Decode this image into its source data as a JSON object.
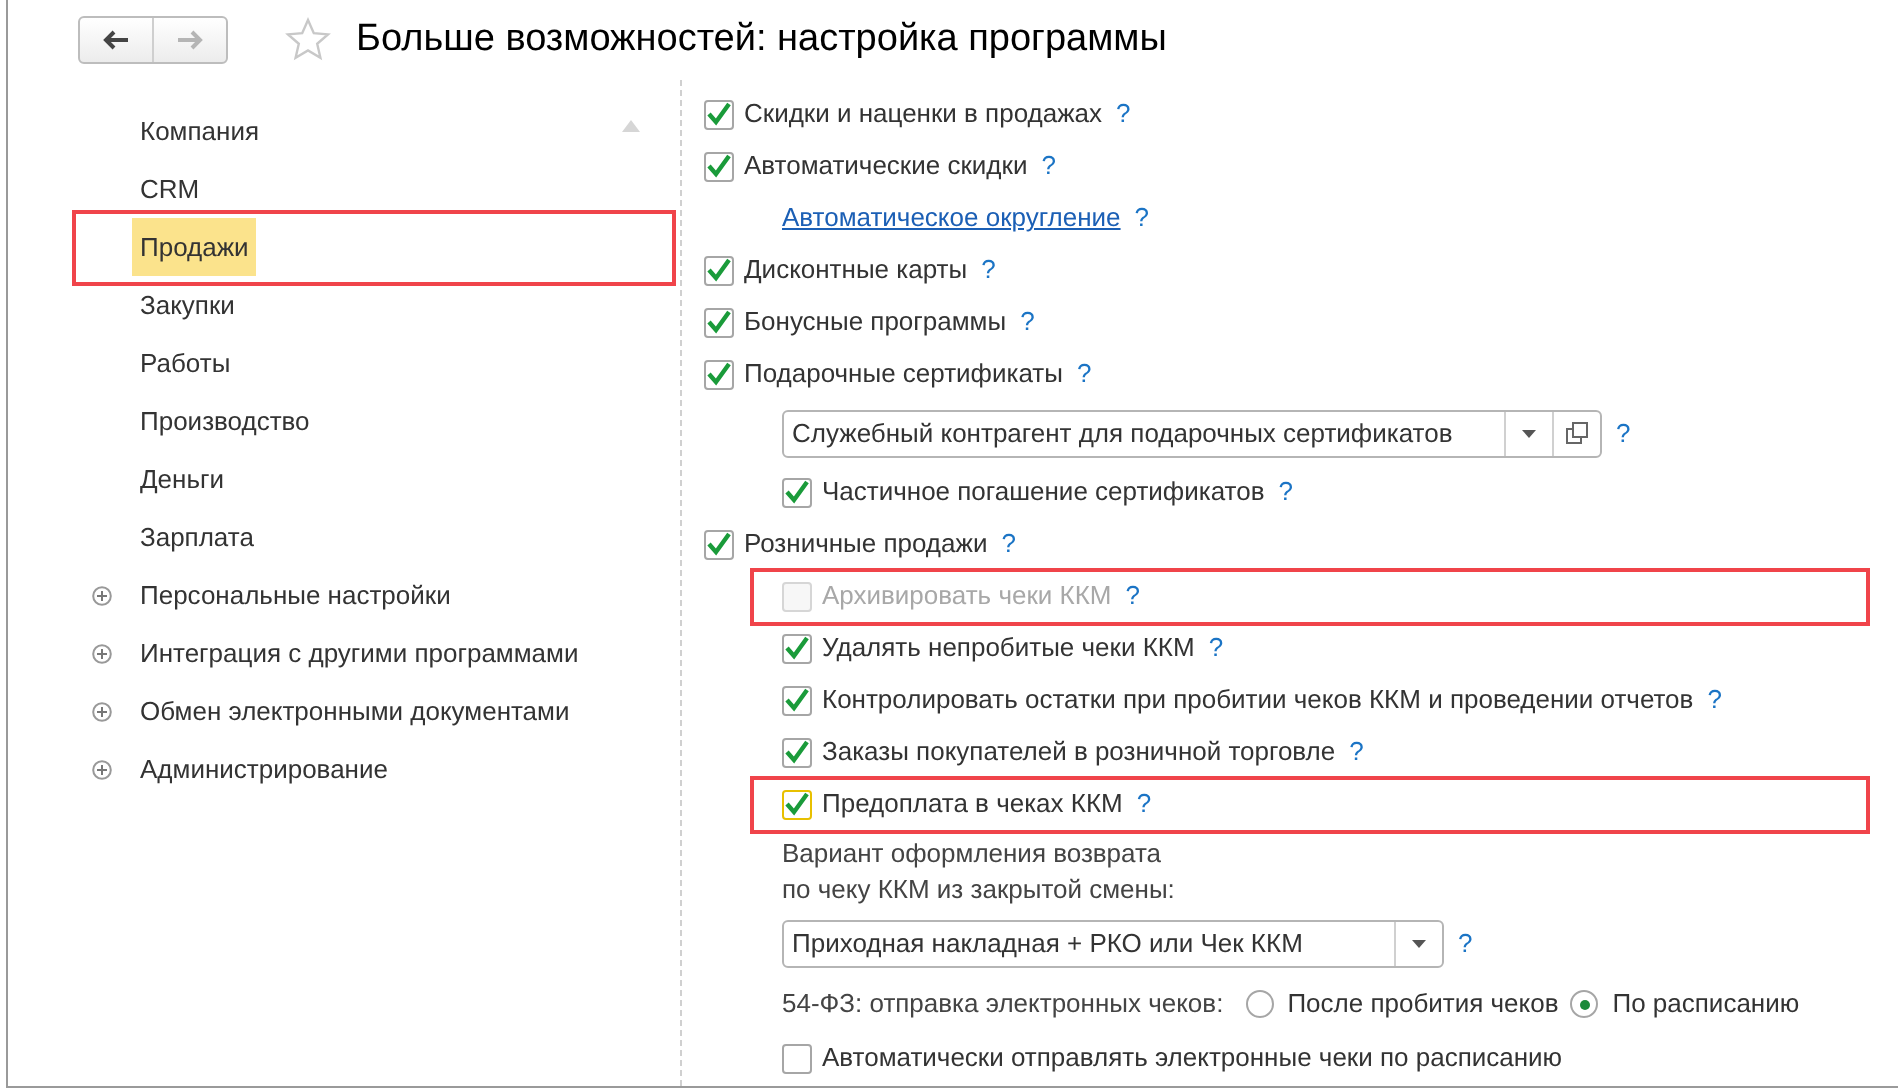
{
  "window": {
    "title": "Больше возможностей: настройка программы",
    "back_enabled": true,
    "forward_enabled": false
  },
  "sidebar": {
    "items": [
      {
        "label": "Компания",
        "selected": false,
        "expandable": false,
        "highlighted": false
      },
      {
        "label": "CRM",
        "selected": false,
        "expandable": false,
        "highlighted": false
      },
      {
        "label": "Продажи",
        "selected": true,
        "expandable": false,
        "highlighted": true
      },
      {
        "label": "Закупки",
        "selected": false,
        "expandable": false,
        "highlighted": false
      },
      {
        "label": "Работы",
        "selected": false,
        "expandable": false,
        "highlighted": false
      },
      {
        "label": "Производство",
        "selected": false,
        "expandable": false,
        "highlighted": false
      },
      {
        "label": "Деньги",
        "selected": false,
        "expandable": false,
        "highlighted": false
      },
      {
        "label": "Зарплата",
        "selected": false,
        "expandable": false,
        "highlighted": false
      },
      {
        "label": "Персональные настройки",
        "selected": false,
        "expandable": true,
        "highlighted": false
      },
      {
        "label": "Интеграция с другими программами",
        "selected": false,
        "expandable": true,
        "highlighted": false
      },
      {
        "label": "Обмен электронными документами",
        "selected": false,
        "expandable": true,
        "highlighted": false
      },
      {
        "label": "Администрирование",
        "selected": false,
        "expandable": true,
        "highlighted": false
      }
    ]
  },
  "settings": [
    {
      "kind": "checkbox",
      "label": "Скидки и наценки в продажах",
      "checked": true,
      "help": "?"
    },
    {
      "kind": "checkbox",
      "label": "Автоматические скидки",
      "checked": true,
      "help": "?",
      "children": [
        {
          "kind": "link",
          "label": "Автоматическое округление",
          "help": "?"
        }
      ]
    },
    {
      "kind": "checkbox",
      "label": "Дисконтные карты",
      "checked": true,
      "help": "?"
    },
    {
      "kind": "checkbox",
      "label": "Бонусные программы",
      "checked": true,
      "help": "?"
    },
    {
      "kind": "checkbox",
      "label": "Подарочные сертификаты",
      "checked": true,
      "help": "?",
      "children": [
        {
          "kind": "combo",
          "value": "Служебный контрагент для подарочных сертификатов",
          "open_button": true,
          "help": "?"
        },
        {
          "kind": "checkbox",
          "label": "Частичное погашение сертификатов",
          "checked": true,
          "help": "?"
        }
      ]
    },
    {
      "kind": "checkbox",
      "label": "Розничные продажи",
      "checked": true,
      "help": "?",
      "children": [
        {
          "kind": "checkbox",
          "label": "Архивировать чеки ККМ",
          "checked": false,
          "disabled": true,
          "highlighted": true,
          "help": "?"
        },
        {
          "kind": "checkbox",
          "label": "Удалять непробитые чеки ККМ",
          "checked": true,
          "help": "?"
        },
        {
          "kind": "checkbox",
          "label": "Контролировать остатки при пробитии чеков ККМ и проведении отчетов",
          "checked": true,
          "help": "?"
        },
        {
          "kind": "checkbox",
          "label": "Заказы покупателей в розничной торговле",
          "checked": true,
          "help": "?"
        },
        {
          "kind": "checkbox",
          "label": "Предоплата в чеках ККМ",
          "checked": true,
          "focused": true,
          "highlighted": true,
          "help": "?"
        },
        {
          "kind": "label",
          "lines": [
            "Вариант оформления возврата",
            "по чеку ККМ из закрытой смены:"
          ]
        },
        {
          "kind": "combo",
          "value": "Приходная накладная + РКО или Чек ККМ",
          "open_button": false,
          "help": "?"
        },
        {
          "kind": "radio",
          "label": "54-ФЗ: отправка электронных чеков:",
          "options": [
            {
              "label": "После пробития чеков",
              "selected": false
            },
            {
              "label": "По расписанию",
              "selected": true
            }
          ]
        },
        {
          "kind": "checkbox",
          "label": "Автоматически отправлять электронные чеки по расписанию",
          "checked": false
        }
      ]
    }
  ]
}
